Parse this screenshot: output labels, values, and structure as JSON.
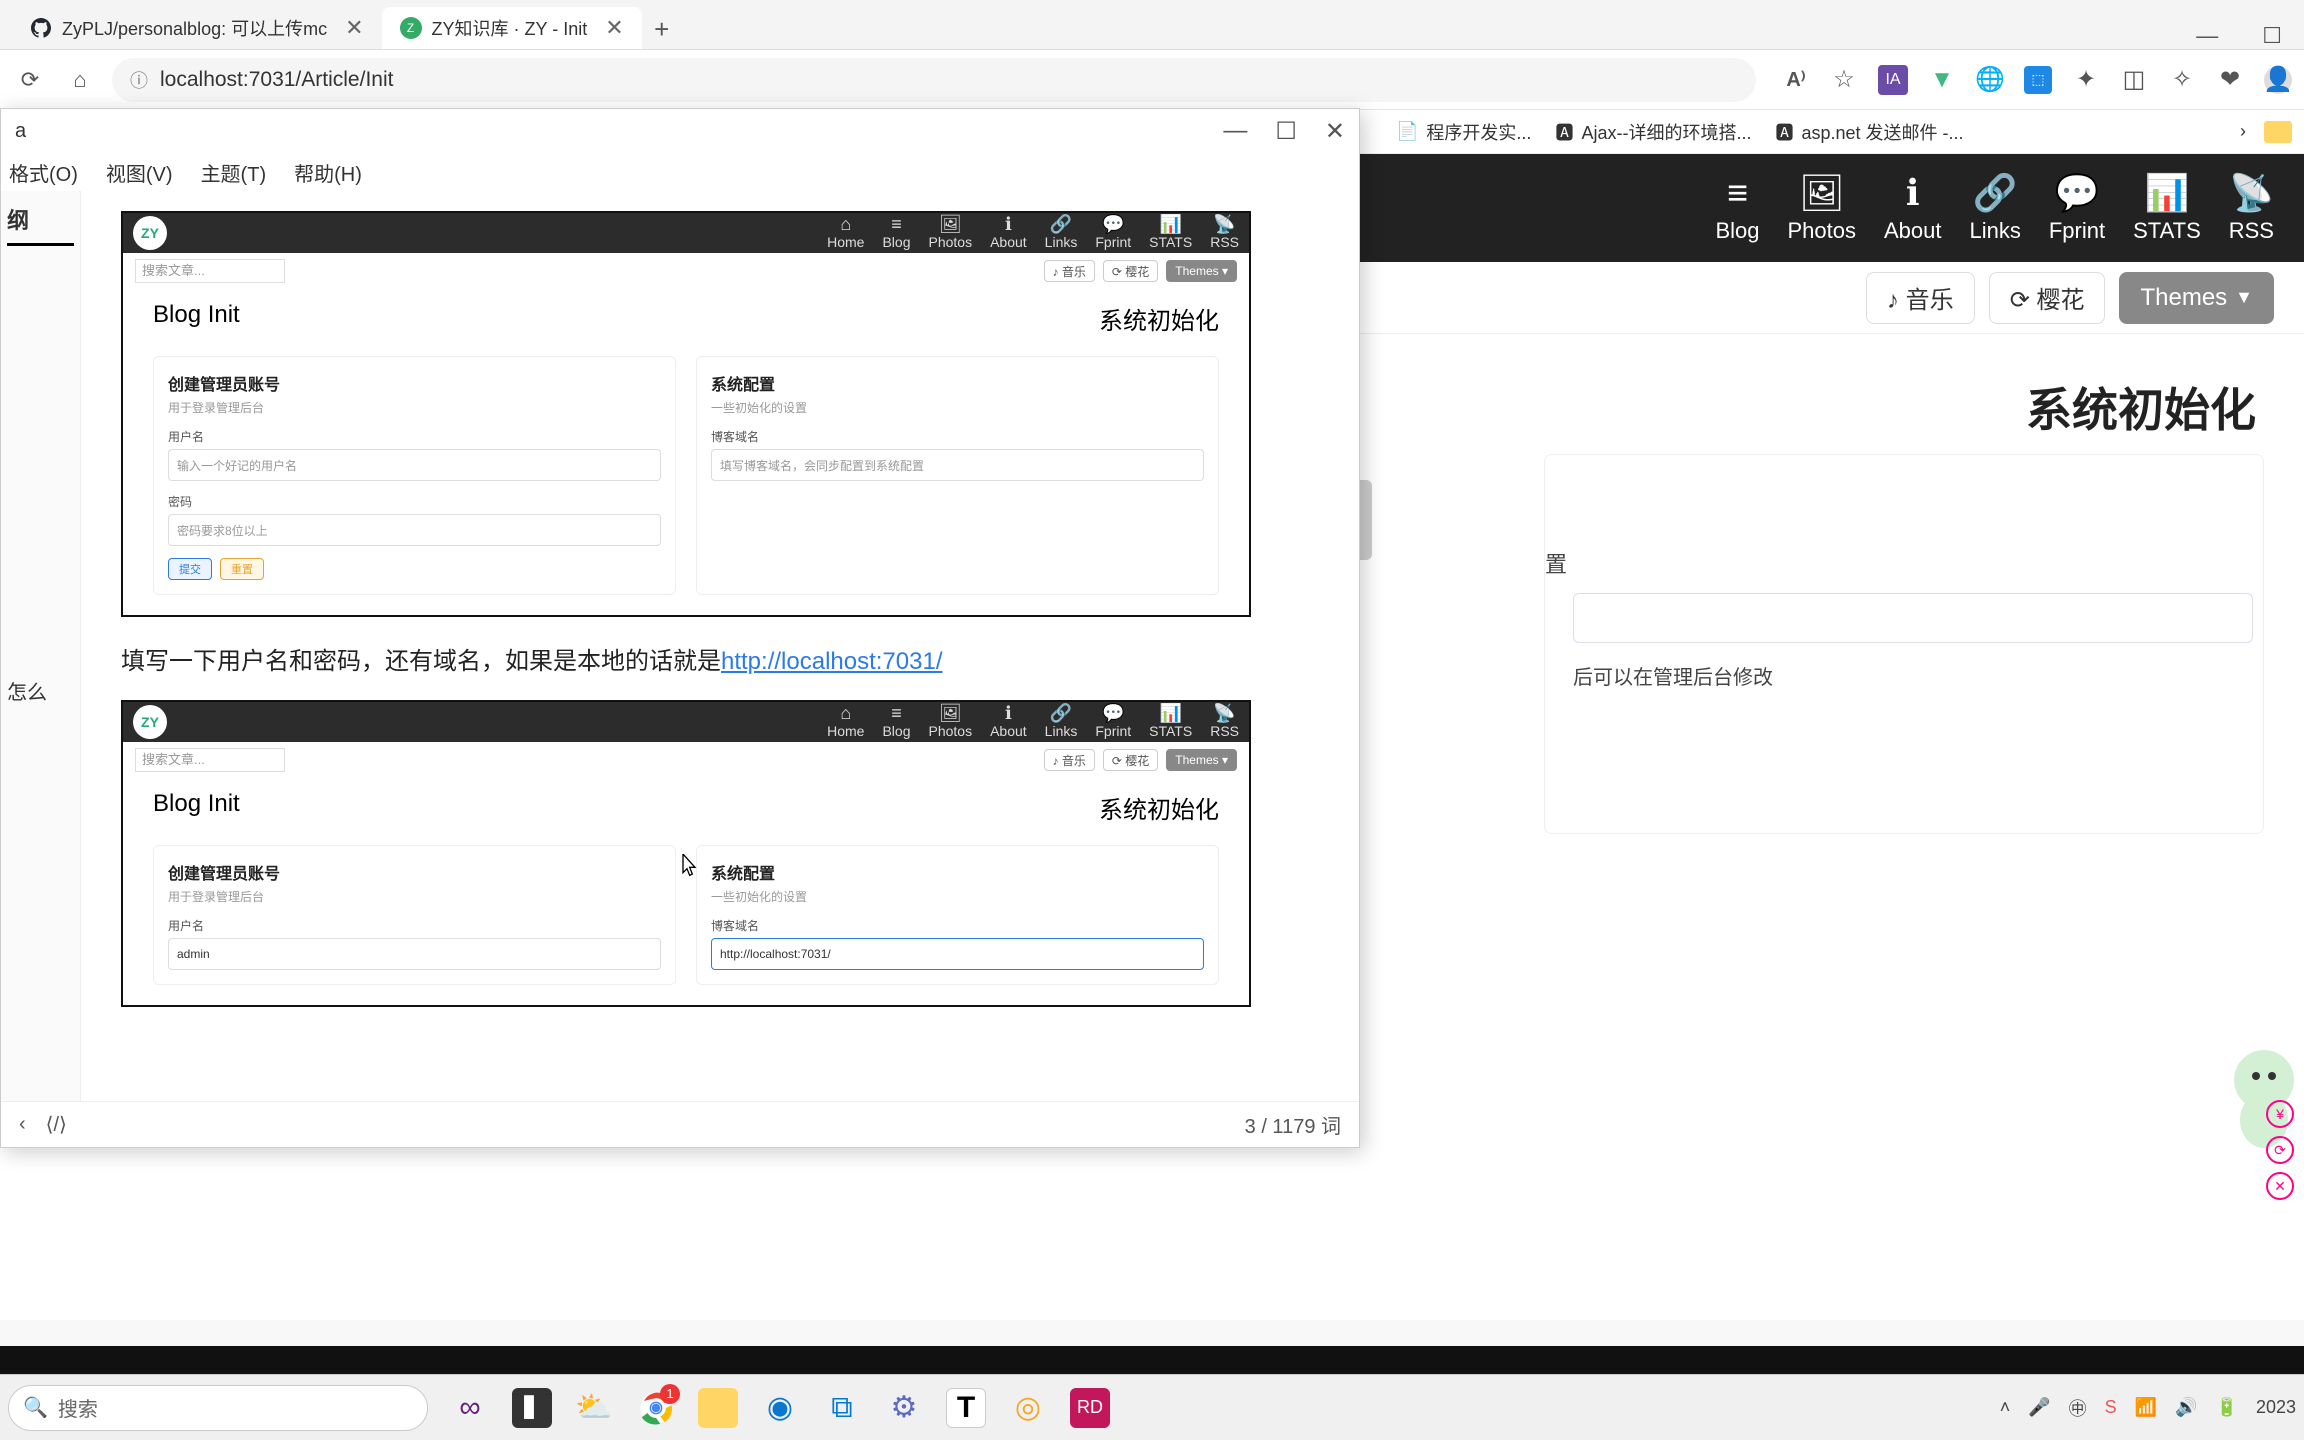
{
  "browser": {
    "tabs": [
      {
        "title": "ZyPLJ/personalblog: 可以上传mc",
        "favicon": "github"
      },
      {
        "title": "ZY知识库 · ZY - Init",
        "favicon": "zy"
      }
    ],
    "url": "localhost:7031/Article/Init"
  },
  "bookmarks": {
    "items": [
      {
        "label": "程序开发实..."
      },
      {
        "label": "Ajax--详细的环境搭..."
      },
      {
        "label": "asp.net 发送邮件 -..."
      }
    ]
  },
  "site_nav": {
    "items": [
      {
        "icon": "≡",
        "label": "Blog"
      },
      {
        "icon": "🖼",
        "label": "Photos"
      },
      {
        "icon": "ℹ",
        "label": "About"
      },
      {
        "icon": "🔗",
        "label": "Links"
      },
      {
        "icon": "💬",
        "label": "Fprint"
      },
      {
        "icon": "📊",
        "label": "STATS"
      },
      {
        "icon": "📡",
        "label": "RSS"
      }
    ]
  },
  "toolbar": {
    "music": "♪ 音乐",
    "sakura": "⟳ 樱花",
    "themes": "Themes"
  },
  "page": {
    "heading_right": "系统初始化",
    "cfg_label_frag": "置",
    "cfg_help": "后可以在管理后台修改",
    "submit": "提交",
    "reset": "重置"
  },
  "editor": {
    "title": "a",
    "menu": {
      "format": "格式(O)",
      "view": "视图(V)",
      "theme": "主题(T)",
      "help": "帮助(H)"
    },
    "outline_head": "纲",
    "outline_item": "怎么",
    "para_before": "填写一下用户名和密码，还有域名，如果是本地的话就是",
    "para_link": "http://localhost:7031/",
    "status_words": "3 / 1179 词",
    "win": {
      "min": "—",
      "max": "☐",
      "close": "✕"
    }
  },
  "shot": {
    "nav": [
      "Home",
      "Blog",
      "Photos",
      "About",
      "Links",
      "Fprint",
      "STATS",
      "RSS"
    ],
    "nav_icons": [
      "⌂",
      "≡",
      "🖼",
      "ℹ",
      "🔗",
      "💬",
      "📊",
      "📡"
    ],
    "search_ph": "搜索文章...",
    "music": "♪ 音乐",
    "sakura": "⟳ 樱花",
    "themes": "Themes ▾",
    "h_left": "Blog Init",
    "h_right": "系统初始化",
    "card1": {
      "h": "创建管理员账号",
      "sub": "用于登录管理后台",
      "l1": "用户名",
      "ph1": "输入一个好记的用户名",
      "l2": "密码",
      "ph2": "密码要求8位以上",
      "b1": "提交",
      "b2": "重置"
    },
    "card2": {
      "h": "系统配置",
      "sub": "一些初始化的设置",
      "l1": "博客域名",
      "ph1": "填写博客域名，会同步配置到系统配置",
      "val1": "http://localhost:7031/",
      "admin_val": "admin"
    }
  },
  "taskbar": {
    "search_ph": "搜索",
    "badge": "1",
    "time_year": "2023"
  }
}
